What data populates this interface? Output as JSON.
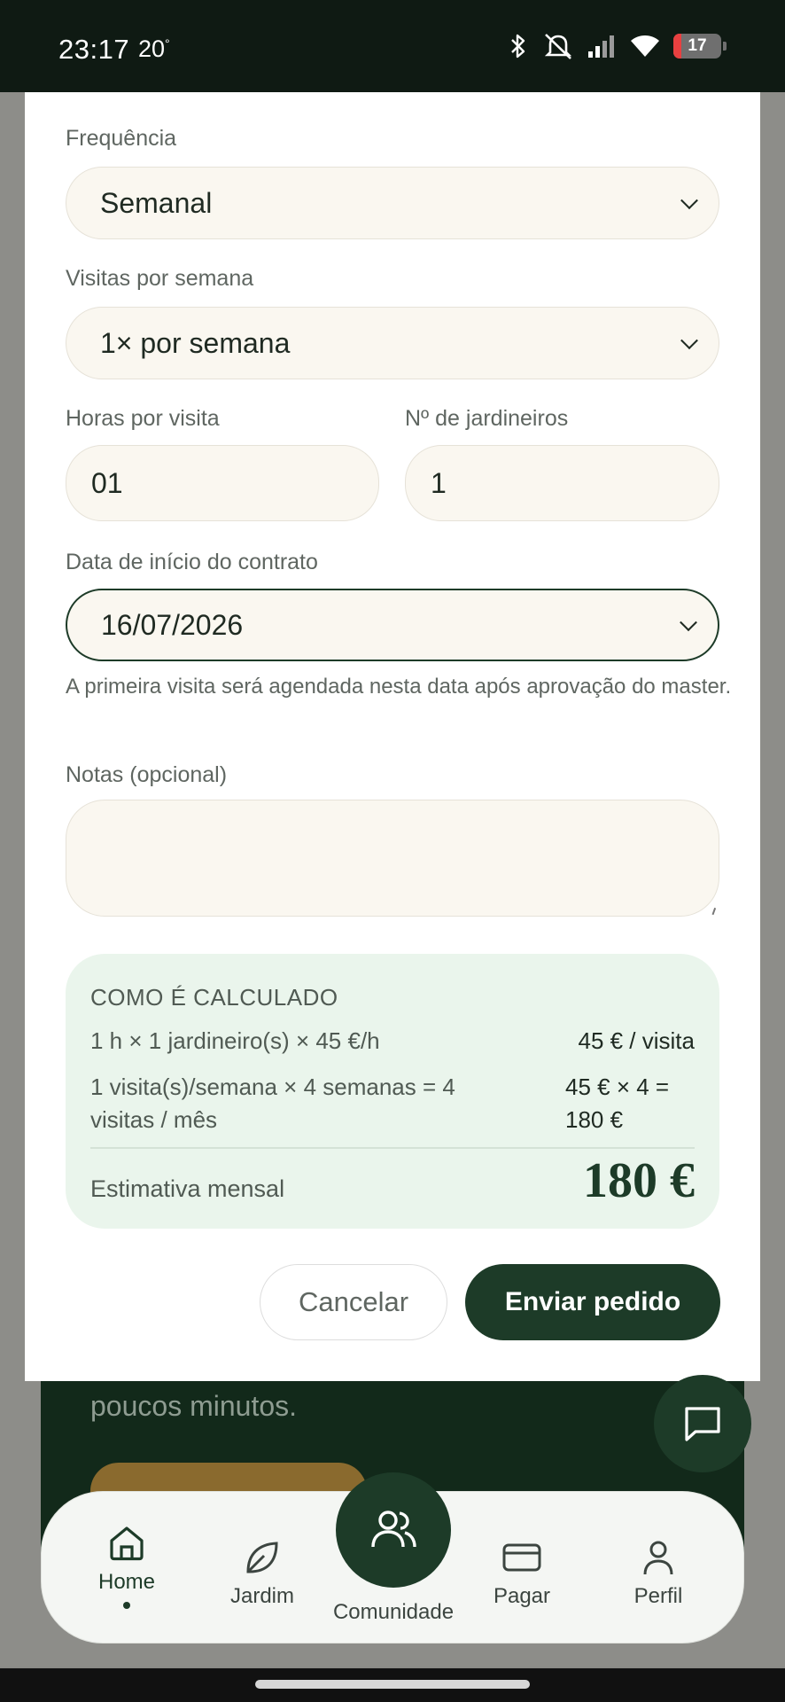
{
  "status_bar": {
    "time": "23:17",
    "temperature": "20",
    "temperature_unit": "°",
    "battery": "17",
    "battery_level": 0.17
  },
  "form": {
    "frequency_label": "Frequência",
    "frequency_value": "Semanal",
    "visits_label": "Visitas por semana",
    "visits_value": "1× por semana",
    "hours_label": "Horas por visita",
    "hours_value": "01",
    "gardeners_label": "Nº de jardineiros",
    "gardeners_value": "1",
    "start_date_label": "Data de início do contrato",
    "start_date_value": "16/07/2026",
    "start_date_helper": "A primeira visita será agendada nesta data após aprovação do master.",
    "notes_label": "Notas (opcional)",
    "notes_value": ""
  },
  "calculation": {
    "title": "COMO É CALCULADO",
    "row1_left": "1 h × 1 jardineiro(s) × 45 €/h",
    "row1_right": "45 € / visita",
    "row2_left_line1": "1 visita(s)/semana × 4 semanas = 4",
    "row2_left_line2": "visitas / mês",
    "row2_right_line1": "45 € × 4 =",
    "row2_right_line2": "180 €",
    "total_label": "Estimativa mensal",
    "total_value": "180 €"
  },
  "actions": {
    "cancel_label": "Cancelar",
    "send_label": "Enviar pedido"
  },
  "background": {
    "card_text_partial": "poucos minutos."
  },
  "nav": {
    "home_label": "Home",
    "garden_label": "Jardim",
    "community_label": "Comunidade",
    "pay_label": "Pagar",
    "profile_label": "Perfil"
  },
  "colors": {
    "primary": "#1d3b28",
    "calc_background": "#eaf5ec",
    "field_background": "#faf7f0"
  }
}
